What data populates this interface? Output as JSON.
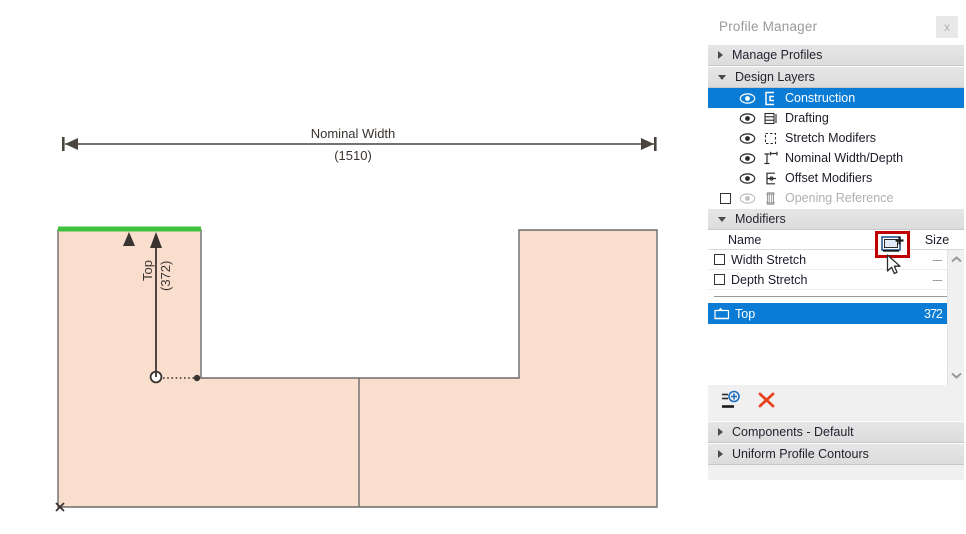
{
  "window": {
    "title": "Profile Manager",
    "close_label": "x"
  },
  "sections": {
    "manage_profiles": {
      "label": "Manage Profiles",
      "expanded": false
    },
    "design_layers": {
      "label": "Design Layers",
      "expanded": true
    },
    "modifiers": {
      "label": "Modifiers",
      "expanded": true
    },
    "components_default": {
      "label": "Components - Default",
      "expanded": false
    },
    "uniform_profile_contours": {
      "label": "Uniform Profile Contours",
      "expanded": false
    }
  },
  "design_layers": {
    "items": [
      {
        "label": "Construction",
        "icon": "construction-layer-icon",
        "selected": true,
        "visible": true,
        "has_checkbox": false,
        "dimmed": false
      },
      {
        "label": "Drafting",
        "icon": "drafting-layer-icon",
        "selected": false,
        "visible": true,
        "has_checkbox": false,
        "dimmed": false
      },
      {
        "label": "Stretch Modifers",
        "icon": "stretch-modifiers-layer-icon",
        "selected": false,
        "visible": true,
        "has_checkbox": false,
        "dimmed": false
      },
      {
        "label": "Nominal Width/Depth",
        "icon": "nominal-width-depth-layer-icon",
        "selected": false,
        "visible": true,
        "has_checkbox": false,
        "dimmed": false
      },
      {
        "label": "Offset Modifiers",
        "icon": "offset-modifiers-layer-icon",
        "selected": false,
        "visible": true,
        "has_checkbox": false,
        "dimmed": false
      },
      {
        "label": "Opening Reference",
        "icon": "opening-reference-layer-icon",
        "selected": false,
        "visible": true,
        "has_checkbox": true,
        "checked": false,
        "dimmed": true
      }
    ]
  },
  "modifiers": {
    "columns": {
      "name": "Name",
      "size": "Size"
    },
    "rows": [
      {
        "name": "Width Stretch",
        "size": "---",
        "checked": false,
        "selected": false
      },
      {
        "name": "Depth Stretch",
        "size": "---",
        "checked": false,
        "selected": false
      }
    ],
    "selected_row": {
      "name": "Top",
      "size": "372",
      "icon": "modifier-top-icon"
    },
    "toolbar": {
      "add_label": "add-modifier",
      "delete_label": "delete-modifier"
    },
    "highlight_icon": "add-to-view-icon"
  },
  "drawing": {
    "nominal_width": {
      "label": "Nominal Width",
      "value": "(1510)"
    },
    "top_modifier": {
      "label": "Top",
      "value": "(372)"
    },
    "origin_marker": "x",
    "colors": {
      "fill": "#f9dece",
      "stroke": "#6b6b6b",
      "highlight": "#3fc33f",
      "dimension": "#4a443f",
      "selection": "#0a7cd5",
      "warning": "#c00000"
    }
  }
}
